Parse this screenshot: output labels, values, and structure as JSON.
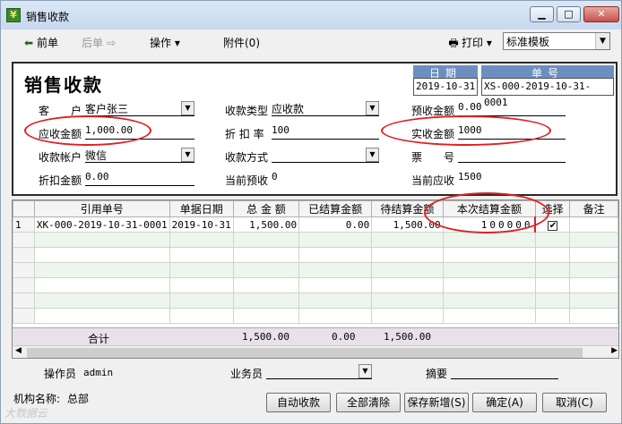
{
  "window": {
    "title": "销售收款",
    "minimize": "▁",
    "maximize": "□",
    "close": "✕"
  },
  "toolbar": {
    "prev": "前单",
    "next": "后单",
    "ops": "操作",
    "attach": "附件(0)",
    "print": "打印",
    "template": "标准模板"
  },
  "form": {
    "title": "销售收款",
    "date_label": "日期",
    "date_value": "2019-10-31",
    "no_label": "单号",
    "no_value": "XS-000-2019-10-31-0001",
    "customer_label": "客　　户",
    "customer_value": "客户张三",
    "receipt_type_label": "收款类型",
    "receipt_type_value": "应收款",
    "prepay_label": "预收金额",
    "prepay_value": "0.00",
    "receivable_label": "应收金额",
    "receivable_value": "1,000.00",
    "discount_rate_label": "折 扣 率",
    "discount_rate_value": "100",
    "actual_label": "实收金额",
    "actual_value": "1000",
    "account_label": "收款帐户",
    "account_value": "微信",
    "method_label": "收款方式",
    "method_value": "",
    "ticket_label": "票　　号",
    "ticket_value": "",
    "discount_amt_label": "折扣金额",
    "discount_amt_value": "0.00",
    "cur_prepay_label": "当前预收",
    "cur_prepay_value": "0",
    "cur_recv_label": "当前应收",
    "cur_recv_value": "1500"
  },
  "grid": {
    "columns": [
      "引用单号",
      "单据日期",
      "总 金 额",
      "已结算金额",
      "待结算金额",
      "本次结算金额",
      "选择",
      "备注"
    ],
    "rows": [
      {
        "idx": "1",
        "ref": "XK-000-2019-10-31-0001",
        "date": "2019-10-31",
        "total": "1,500.00",
        "settled": "0.00",
        "pending": "1,500.00",
        "current": "100000",
        "checked": "✔",
        "note": ""
      }
    ],
    "sum_label": "合计",
    "sum_total": "1,500.00",
    "sum_settled": "0.00",
    "sum_pending": "1,500.00"
  },
  "footer": {
    "operator_label": "操作员",
    "operator_value": "admin",
    "salesman_label": "业务员",
    "summary_label": "摘要",
    "org_label": "机构名称:",
    "org_value": "总部",
    "btn_auto": "自动收款",
    "btn_clear": "全部清除",
    "btn_save_new": "保存新增(S)",
    "btn_ok": "确定(A)",
    "btn_cancel": "取消(C)",
    "watermark": "大数据云"
  },
  "colors": {
    "header_blue": "#6b8fbf",
    "highlight_red": "#e02020"
  }
}
